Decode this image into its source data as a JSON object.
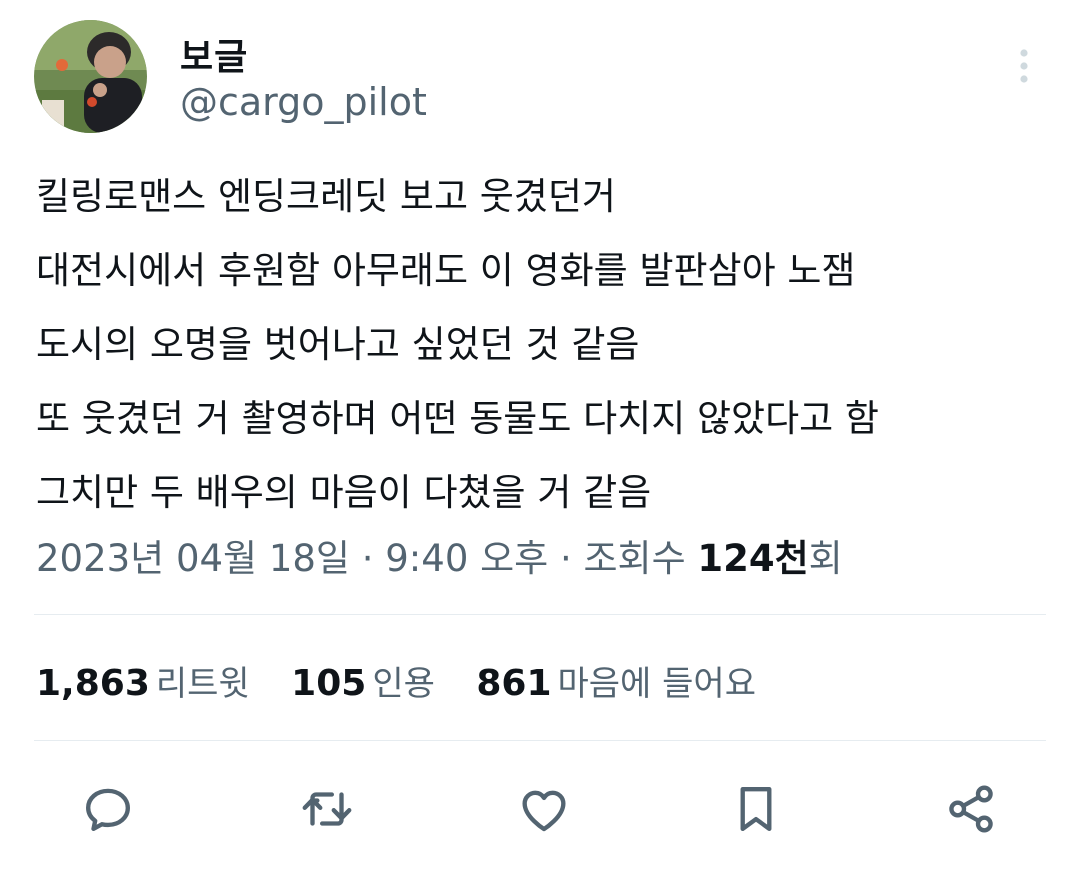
{
  "author": {
    "display_name": "보글",
    "handle": "@cargo_pilot"
  },
  "icons": {
    "more": "more-vertical-icon",
    "reply": "reply-icon",
    "retweet": "retweet-icon",
    "like": "heart-icon",
    "bookmark": "bookmark-icon",
    "share": "share-icon"
  },
  "tweet": {
    "lines": [
      "킬링로맨스 엔딩크레딧 보고 웃겼던거",
      "대전시에서 후원함 아무래도 이 영화를 발판삼아 노잼",
      "도시의 오명을 벗어나고 싶었던 것 같음",
      "또 웃겼던 거 촬영하며 어떤 동물도 다치지 않았다고 함",
      "그치만 두 배우의 마음이 다쳤을 거 같음"
    ]
  },
  "meta": {
    "date": "2023년 04월 18일",
    "sep1": " · ",
    "time": "9:40 오후",
    "sep2": " · ",
    "views_label": "조회수 ",
    "views_count": "124천",
    "views_suffix": "회"
  },
  "stats": {
    "retweets": {
      "count": "1,863",
      "label": "리트윗"
    },
    "quotes": {
      "count": "105",
      "label": "인용"
    },
    "likes": {
      "count": "861",
      "label": "마음에 들어요"
    }
  },
  "colors": {
    "text": "#0f1419",
    "secondary": "#536471",
    "divider": "#e6ecf0"
  }
}
